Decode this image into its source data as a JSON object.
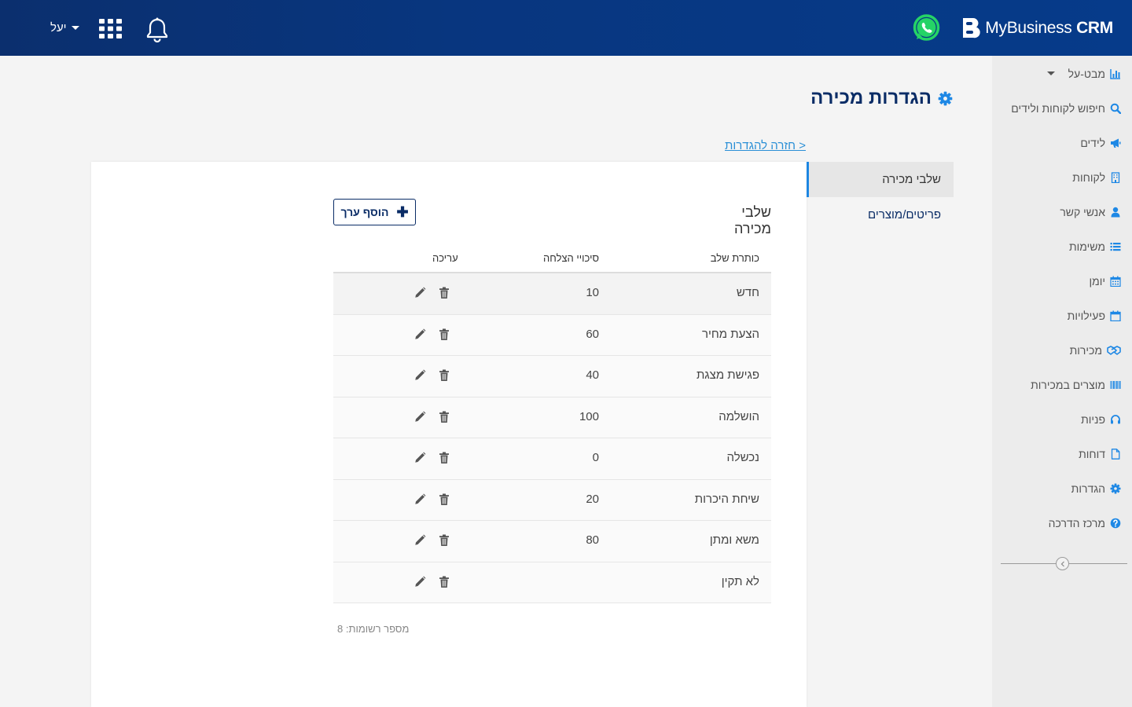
{
  "header": {
    "brand_name": "MyBusiness",
    "brand_suffix": "CRM",
    "user_name": "יעל",
    "icons": [
      "whatsapp-icon",
      "bell-icon",
      "apps-grid-icon"
    ]
  },
  "sidebar": {
    "items": [
      {
        "label": "מבט-על",
        "icon": "bar-chart-icon"
      },
      {
        "label": "חיפוש לקוחות ולידים",
        "icon": "search-icon"
      },
      {
        "label": "לידים",
        "icon": "megaphone-icon"
      },
      {
        "label": "לקוחות",
        "icon": "building-icon"
      },
      {
        "label": "אנשי קשר",
        "icon": "user-icon"
      },
      {
        "label": "משימות",
        "icon": "list-icon"
      },
      {
        "label": "יומן",
        "icon": "calendar-grid-icon"
      },
      {
        "label": "פעילויות",
        "icon": "calendar-icon"
      },
      {
        "label": "מכירות",
        "icon": "handshake-icon"
      },
      {
        "label": "מוצרים במכירות",
        "icon": "barcode-icon"
      },
      {
        "label": "פניות",
        "icon": "headset-icon"
      },
      {
        "label": "דוחות",
        "icon": "file-icon"
      },
      {
        "label": "הגדרות",
        "icon": "gear-icon"
      },
      {
        "label": "מרכז הדרכה",
        "icon": "question-icon"
      }
    ]
  },
  "page": {
    "title": "הגדרות מכירה",
    "back_link": "< חזרה להגדרות",
    "tabs": [
      {
        "label": "שלבי מכירה",
        "active": true
      },
      {
        "label": "פריטים/מוצרים",
        "active": false
      }
    ]
  },
  "section": {
    "title": "שלבי מכירה",
    "add_button": "הוסף ערך",
    "columns": {
      "title": "כותרת שלב",
      "probability": "סיכויי הצלחה",
      "edit": "עריכה"
    },
    "rows": [
      {
        "title": "חדש",
        "probability": "10"
      },
      {
        "title": "הצעת מחיר",
        "probability": "60"
      },
      {
        "title": "פגישת מצגת",
        "probability": "40"
      },
      {
        "title": "הושלמה",
        "probability": "100"
      },
      {
        "title": "נכשלה",
        "probability": "0"
      },
      {
        "title": "שיחת היכרות",
        "probability": "20"
      },
      {
        "title": "משא ומתן",
        "probability": "80"
      },
      {
        "title": "לא תקין",
        "probability": ""
      }
    ],
    "record_count": "מספר רשומות: 8"
  },
  "colors": {
    "header_bg": "#08367f",
    "accent_blue": "#1e88e5",
    "title_navy": "#0a2c66",
    "whatsapp_green": "#25d366"
  }
}
